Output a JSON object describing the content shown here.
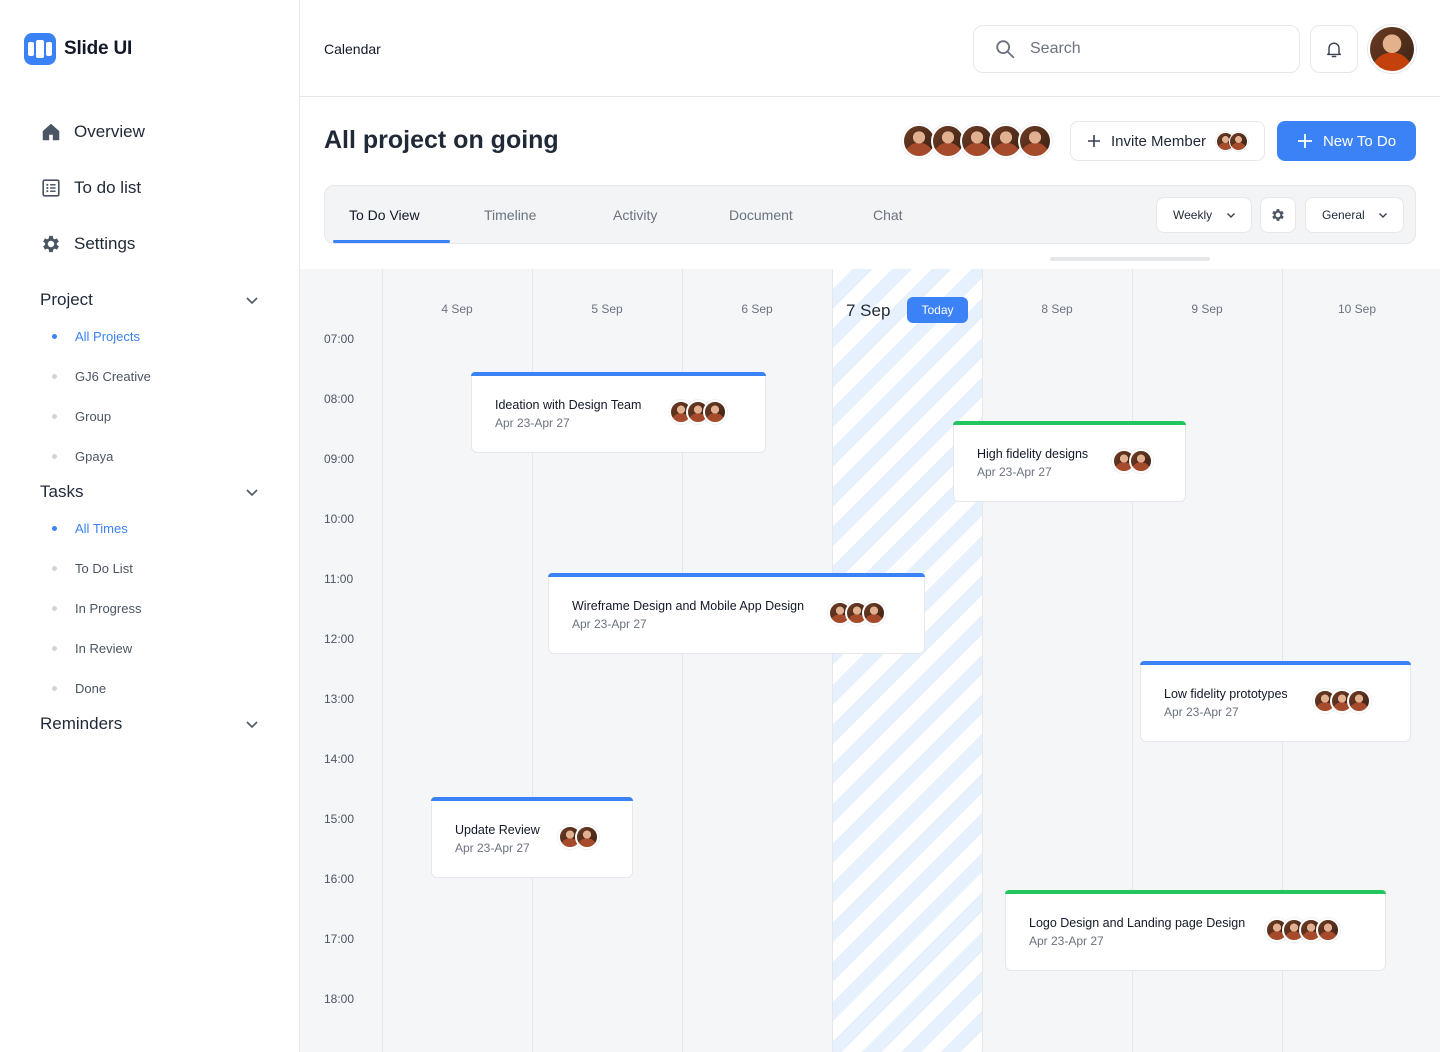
{
  "app": {
    "name": "Slide UI"
  },
  "sidebar": {
    "nav": [
      {
        "label": "Overview",
        "icon": "home-icon"
      },
      {
        "label": "To do list",
        "icon": "list-icon"
      },
      {
        "label": "Settings",
        "icon": "gear-icon"
      }
    ],
    "sections": [
      {
        "title": "Project",
        "items": [
          "All Projects",
          "GJ6 Creative",
          "Group",
          "Gpaya"
        ],
        "active": "All Projects"
      },
      {
        "title": "Tasks",
        "items": [
          "All Times",
          "To Do List",
          "In Progress",
          "In Review",
          "Done"
        ],
        "active": "All Times"
      },
      {
        "title": "Reminders",
        "items": []
      }
    ]
  },
  "header": {
    "page": "Calendar",
    "search_placeholder": "Search"
  },
  "title_row": {
    "title": "All project on going",
    "invite_label": "Invite Member",
    "new_label": "New To Do"
  },
  "tabs": {
    "items": [
      "To Do View",
      "Timeline",
      "Activity",
      "Document",
      "Chat"
    ],
    "active": "To Do View",
    "view_select": "Weekly",
    "category_select": "General"
  },
  "calendar": {
    "days": [
      "4 Sep",
      "5 Sep",
      "6 Sep",
      "7 Sep",
      "8 Sep",
      "9 Sep",
      "10 Sep"
    ],
    "today": "7 Sep",
    "today_badge": "Today",
    "times": [
      "07:00",
      "08:00",
      "09:00",
      "10:00",
      "11:00",
      "12:00",
      "13:00",
      "14:00",
      "15:00",
      "16:00",
      "17:00",
      "18:00"
    ],
    "events": [
      {
        "title": "Ideation with Design Team",
        "date": "Apr 23-Apr 27",
        "accent": "#3b82f6",
        "members": 3
      },
      {
        "title": "High fidelity designs",
        "date": "Apr 23-Apr 27",
        "accent": "#22c55e",
        "members": 2
      },
      {
        "title": "Wireframe Design and Mobile App Design",
        "date": "Apr 23-Apr 27",
        "accent": "#3b82f6",
        "members": 3
      },
      {
        "title": "Low fidelity prototypes",
        "date": "Apr 23-Apr 27",
        "accent": "#3b82f6",
        "members": 3
      },
      {
        "title": "Update Review",
        "date": "Apr 23-Apr 27",
        "accent": "#3b82f6",
        "members": 2
      },
      {
        "title": "Logo Design and Landing page Design",
        "date": "Apr 23-Apr 27",
        "accent": "#22c55e",
        "members": 4
      }
    ]
  },
  "colors": {
    "accent": "#3b82f6",
    "success": "#22c55e",
    "today_stripe": "#e7f0fd"
  }
}
